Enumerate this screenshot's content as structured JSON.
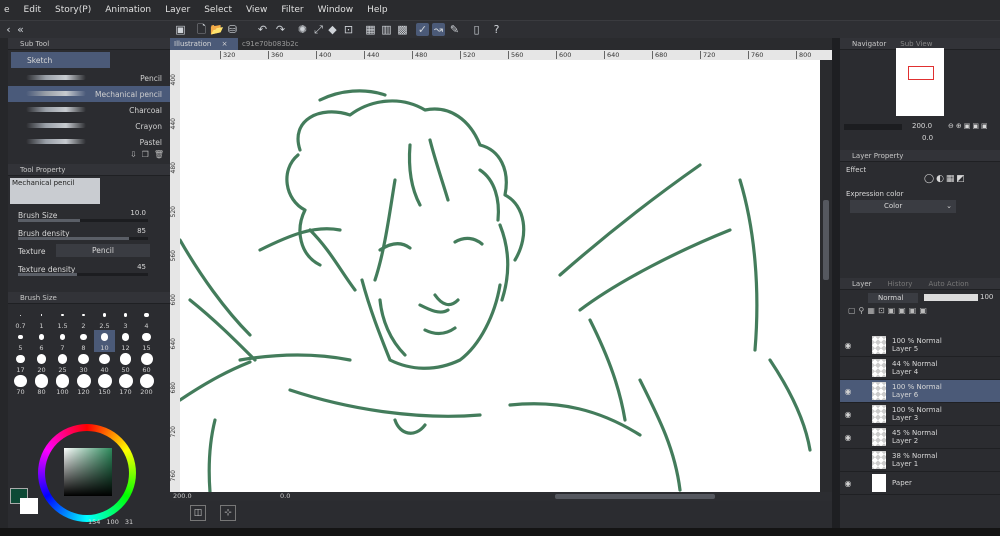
{
  "menu": [
    "e",
    "Edit",
    "Story(P)",
    "Animation",
    "Layer",
    "Select",
    "View",
    "Filter",
    "Window",
    "Help"
  ],
  "subtool": {
    "header": "Sub Tool",
    "group": "Sketch",
    "brushes": [
      "Pencil",
      "Mechanical pencil",
      "Charcoal",
      "Crayon",
      "Pastel"
    ],
    "selected_index": 1
  },
  "tool_property": {
    "header": "Tool Property",
    "preset_name": "Mechanical pencil",
    "brush_size_label": "Brush Size",
    "brush_size_value": "10.0",
    "brush_density_label": "Brush density",
    "brush_density_value": "85",
    "texture_label": "Texture",
    "texture_value": "Pencil",
    "texture_density_label": "Texture density",
    "texture_density_value": "45"
  },
  "brush_size": {
    "header": "Brush Size",
    "sizes": [
      "0.7",
      "1",
      "1.5",
      "2",
      "2.5",
      "3",
      "4",
      "5",
      "6",
      "7",
      "8",
      "10",
      "12",
      "15",
      "17",
      "20",
      "25",
      "30",
      "40",
      "50",
      "60",
      "70",
      "80",
      "100",
      "120",
      "150",
      "170",
      "200"
    ],
    "selected": "10"
  },
  "color": {
    "main": "#0d4a36",
    "sub": "#ffffff",
    "wheel_square": "#2d8a5c",
    "readout": [
      "154",
      "100",
      "31"
    ]
  },
  "canvas": {
    "tab_label": "Illustration",
    "tab_file": "c91e70b083b2c",
    "ruler_ticks": [
      "320",
      "360",
      "400",
      "440",
      "480",
      "520",
      "560",
      "600",
      "640",
      "680",
      "720",
      "760",
      "800",
      "84"
    ],
    "vruler_ticks": [
      "400",
      "440",
      "480",
      "520",
      "560",
      "600",
      "640",
      "680",
      "720",
      "760"
    ],
    "zoom": "200.0",
    "angle": "0.0",
    "stroke_color": "#2f6e4a"
  },
  "navigator": {
    "tabs": [
      "Navigator",
      "Sub View"
    ],
    "zoom": "200.0",
    "angle": "0.0"
  },
  "layer_property": {
    "header": "Layer Property",
    "effect_label": "Effect",
    "expression_label": "Expression color",
    "expression_value": "Color"
  },
  "layers": {
    "tabs": [
      "Layer",
      "History",
      "Auto Action"
    ],
    "blend_mode": "Normal",
    "opacity": "100",
    "items": [
      {
        "mode": "100 % Normal",
        "name": "Layer 5",
        "visible": true,
        "selected": false
      },
      {
        "mode": "44 % Normal",
        "name": "Layer 4",
        "visible": false,
        "selected": false
      },
      {
        "mode": "100 % Normal",
        "name": "Layer 6",
        "visible": true,
        "selected": true
      },
      {
        "mode": "100 % Normal",
        "name": "Layer 3",
        "visible": true,
        "selected": false
      },
      {
        "mode": "45 % Normal",
        "name": "Layer 2",
        "visible": true,
        "selected": false
      },
      {
        "mode": "38 % Normal",
        "name": "Layer 1",
        "visible": false,
        "selected": false
      },
      {
        "mode": "",
        "name": "Paper",
        "visible": true,
        "selected": false
      }
    ]
  }
}
